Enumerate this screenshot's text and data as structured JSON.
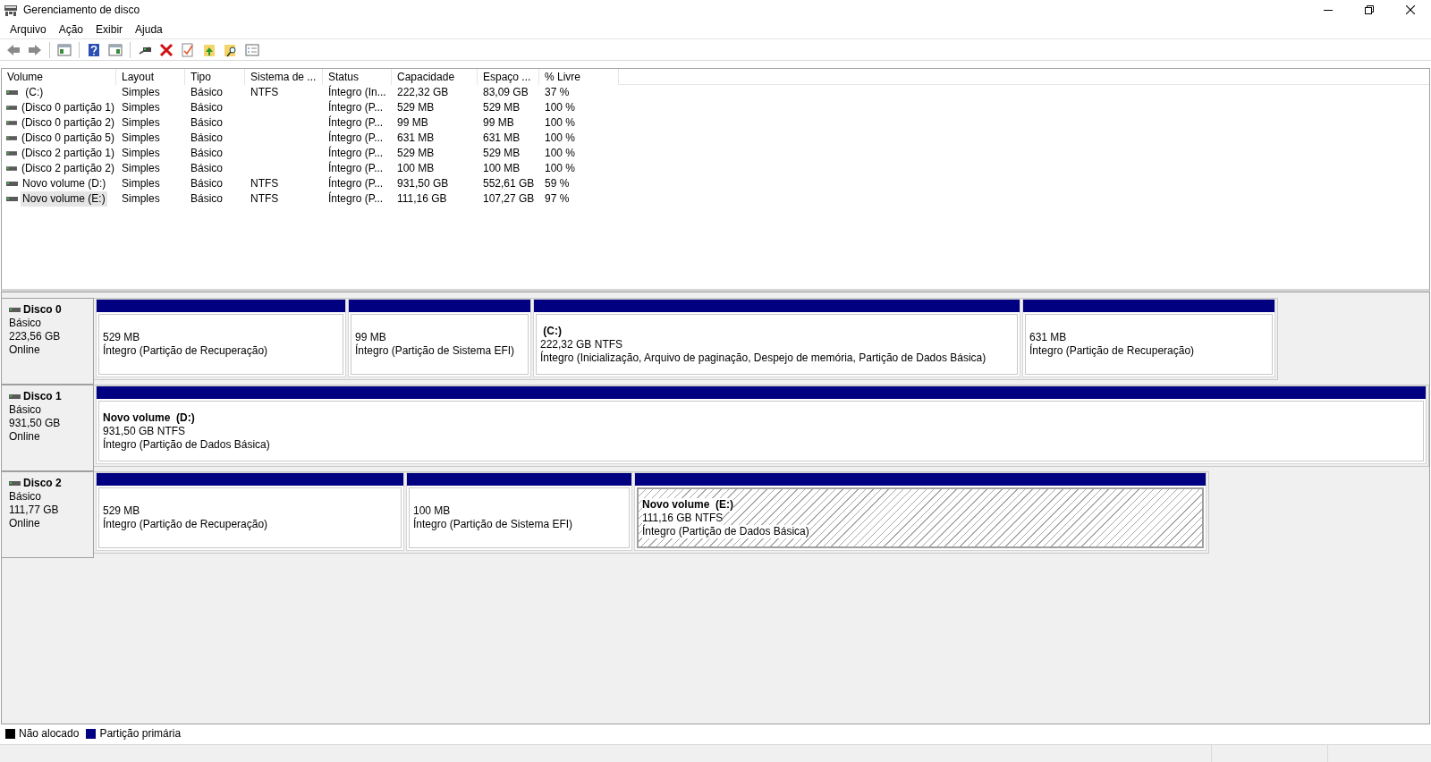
{
  "window": {
    "title": "Gerenciamento de disco"
  },
  "menu": [
    {
      "label": "Arquivo"
    },
    {
      "label": "Ação"
    },
    {
      "label": "Exibir"
    },
    {
      "label": "Ajuda"
    }
  ],
  "volume_list": {
    "columns": [
      "Volume",
      "Layout",
      "Tipo",
      "Sistema de ...",
      "Status",
      "Capacidade",
      "Espaço ...",
      "% Livre"
    ],
    "rows": [
      {
        "selected": false,
        "cells": [
          " (C:)",
          "Simples",
          "Básico",
          "NTFS",
          "Íntegro (In...",
          "222,32 GB",
          "83,09 GB",
          "37 %"
        ]
      },
      {
        "selected": false,
        "cells": [
          "(Disco 0 partição 1)",
          "Simples",
          "Básico",
          "",
          "Íntegro (P...",
          "529 MB",
          "529 MB",
          "100 %"
        ]
      },
      {
        "selected": false,
        "cells": [
          "(Disco 0 partição 2)",
          "Simples",
          "Básico",
          "",
          "Íntegro (P...",
          "99 MB",
          "99 MB",
          "100 %"
        ]
      },
      {
        "selected": false,
        "cells": [
          "(Disco 0 partição 5)",
          "Simples",
          "Básico",
          "",
          "Íntegro (P...",
          "631 MB",
          "631 MB",
          "100 %"
        ]
      },
      {
        "selected": false,
        "cells": [
          "(Disco 2 partição 1)",
          "Simples",
          "Básico",
          "",
          "Íntegro (P...",
          "529 MB",
          "529 MB",
          "100 %"
        ]
      },
      {
        "selected": false,
        "cells": [
          "(Disco 2 partição 2)",
          "Simples",
          "Básico",
          "",
          "Íntegro (P...",
          "100 MB",
          "100 MB",
          "100 %"
        ]
      },
      {
        "selected": false,
        "cells": [
          "Novo volume (D:)",
          "Simples",
          "Básico",
          "NTFS",
          "Íntegro (P...",
          "931,50 GB",
          "552,61 GB",
          "59 %"
        ]
      },
      {
        "selected": true,
        "cells": [
          "Novo volume (E:)",
          "Simples",
          "Básico",
          "NTFS",
          "Íntegro (P...",
          "111,16 GB",
          "107,27 GB",
          "97 %"
        ]
      }
    ]
  },
  "disks": [
    {
      "name": "Disco 0",
      "type": "Básico",
      "size": "223,56 GB",
      "status": "Online",
      "partitions": [
        {
          "selected": false,
          "size": "529 MB",
          "status": "Íntegro (Partição de Recuperação)"
        },
        {
          "selected": false,
          "size": "99 MB",
          "status": "Íntegro (Partição de Sistema EFI)"
        },
        {
          "selected": false,
          "title": " (C:)",
          "size": "222,32 GB NTFS",
          "status": "Íntegro (Inicialização, Arquivo de paginação, Despejo de memória, Partição de Dados Básica)"
        },
        {
          "selected": false,
          "size": "631 MB",
          "status": "Íntegro (Partição de Recuperação)"
        }
      ]
    },
    {
      "name": "Disco 1",
      "type": "Básico",
      "size": "931,50 GB",
      "status": "Online",
      "partitions": [
        {
          "selected": false,
          "title": "Novo volume  (D:)",
          "size": "931,50 GB NTFS",
          "status": "Íntegro (Partição de Dados Básica)"
        }
      ]
    },
    {
      "name": "Disco 2",
      "type": "Básico",
      "size": "111,77 GB",
      "status": "Online",
      "partitions": [
        {
          "selected": false,
          "size": "529 MB",
          "status": "Íntegro (Partição de Recuperação)"
        },
        {
          "selected": false,
          "size": "100 MB",
          "status": "Íntegro (Partição de Sistema EFI)"
        },
        {
          "selected": true,
          "title": "Novo volume  (E:)",
          "size": "111,16 GB NTFS",
          "status": "Íntegro (Partição de Dados Básica)"
        }
      ]
    }
  ],
  "legend": [
    {
      "label": "Não alocado",
      "color": "#000000"
    },
    {
      "label": "Partição primária",
      "color": "#000080"
    }
  ]
}
